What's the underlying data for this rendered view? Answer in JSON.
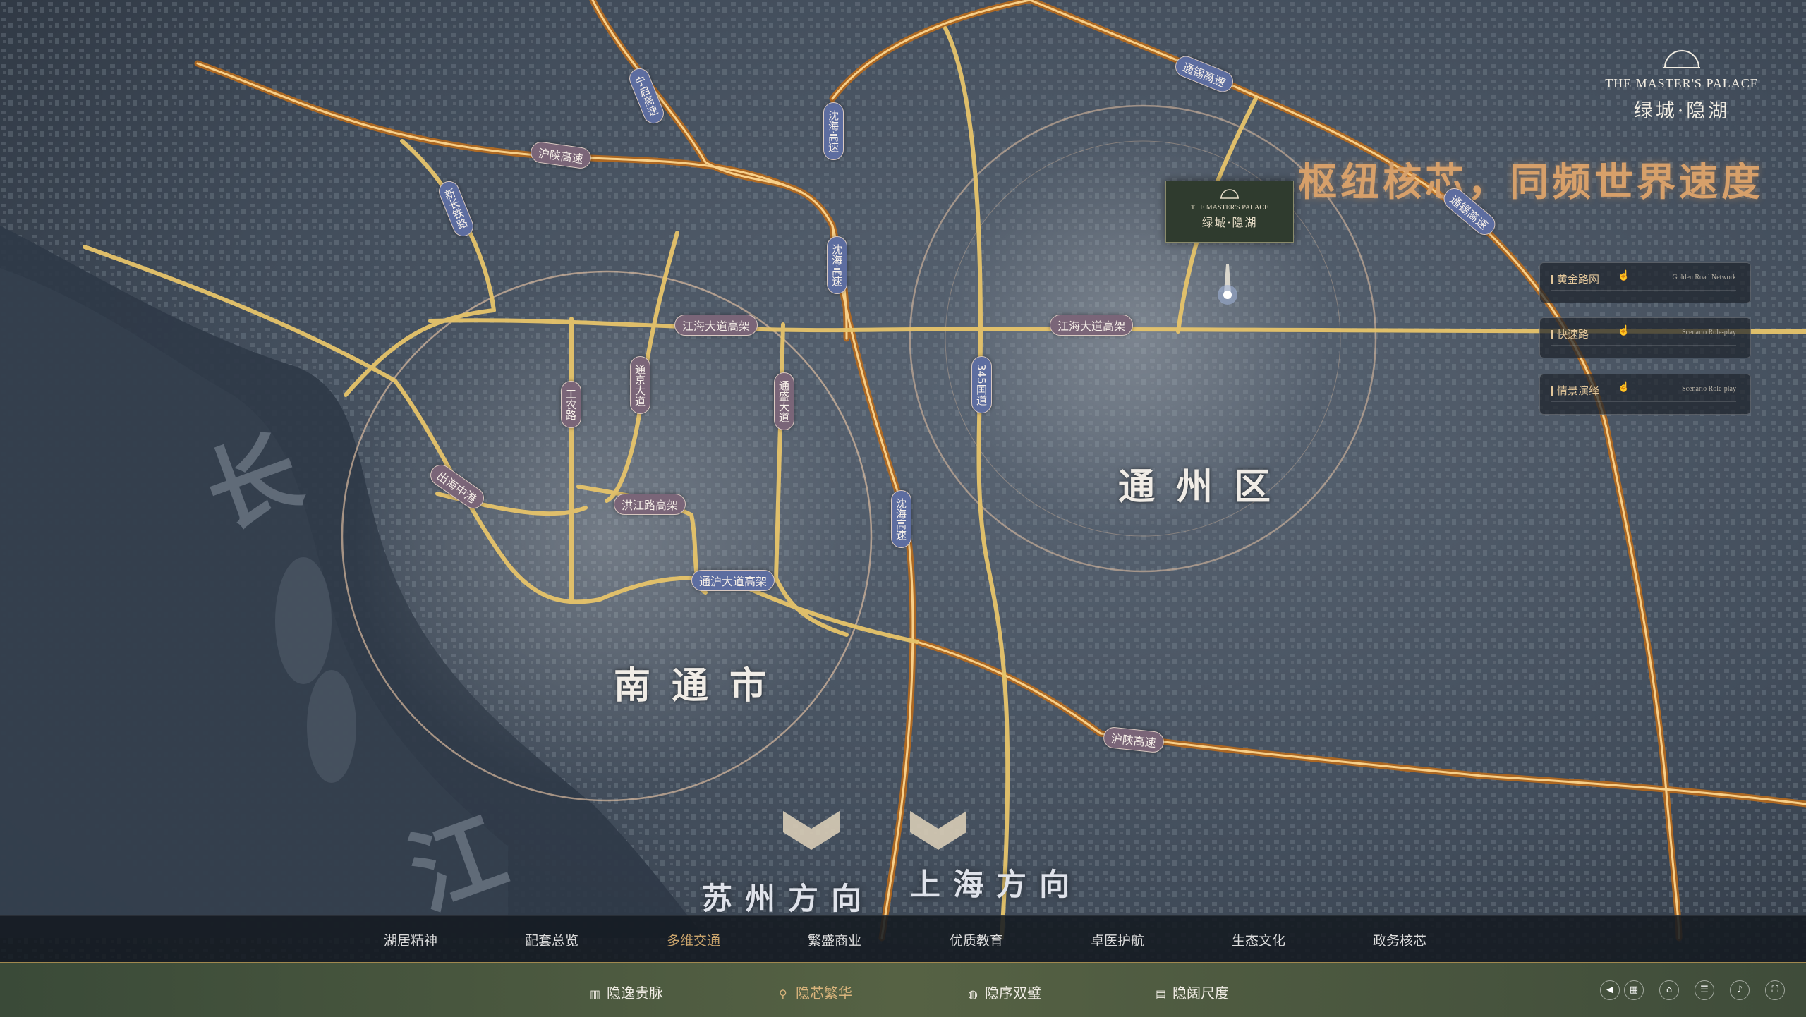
{
  "brand": {
    "name_en": "THE MASTER'S PALACE",
    "name_cn": "绿城·隐湖"
  },
  "headline": "枢纽核芯，同频世界速度",
  "marker": {
    "name_en": "THE MASTER'S PALACE",
    "name_cn": "绿城·隐湖"
  },
  "panels": [
    {
      "label": "黄金路网",
      "en": "Golden Road Network",
      "icon": "hand-pointer-icon"
    },
    {
      "label": "快速路",
      "en": "Scenario Role-play",
      "icon": "hand-pointer-icon"
    },
    {
      "label": "情景演绎",
      "en": "Scenario Role-play",
      "icon": "hand-pointer-icon"
    }
  ],
  "districts": {
    "tongzhou": "通州区",
    "nantong": "南通市"
  },
  "river": {
    "char1": "长",
    "char2": "江"
  },
  "roads": {
    "hushan_top": "沪陕高速",
    "hushan_bottom": "沪陕高速",
    "tongxi_1": "通锡高速",
    "tongxi_2": "通锡高速",
    "jianghai_west": "江海大道高架",
    "jianghai_east": "江海大道高架",
    "hongjiang": "洪江路高架",
    "tonghu": "通沪大道高架",
    "chuhai": "出海中港",
    "shenhai_1": "沈海高速",
    "shenhai_2": "沈海高速",
    "shenhai_3": "沈海高速",
    "gongnong": "工农路",
    "tongjing": "通京大道",
    "tongsheng": "通盛大道",
    "g345": "345国道",
    "ningqi": "宁启高速",
    "xinshiji": "新长铁路"
  },
  "directions": {
    "suzhou": "苏州方向",
    "shanghai": "上海方向"
  },
  "nav_primary": [
    {
      "label": "湖居精神",
      "active": false
    },
    {
      "label": "配套总览",
      "active": false
    },
    {
      "label": "多维交通",
      "active": true
    },
    {
      "label": "繁盛商业",
      "active": false
    },
    {
      "label": "优质教育",
      "active": false
    },
    {
      "label": "卓医护航",
      "active": false
    },
    {
      "label": "生态文化",
      "active": false
    },
    {
      "label": "政务核芯",
      "active": false
    }
  ],
  "nav_secondary": [
    {
      "label": "隐逸贵脉",
      "icon": "building-icon",
      "active": false
    },
    {
      "label": "隐芯繁华",
      "icon": "pin-icon",
      "active": true
    },
    {
      "label": "隐序双璧",
      "icon": "globe-icon",
      "active": false
    },
    {
      "label": "隐阔尺度",
      "icon": "chart-icon",
      "active": false
    }
  ],
  "tools": [
    {
      "icon": "back-icon",
      "glyph": "◀"
    },
    {
      "icon": "gallery-icon",
      "glyph": "▦"
    },
    {
      "icon": "home-icon",
      "glyph": "⌂"
    },
    {
      "icon": "menu-icon",
      "glyph": "☰"
    },
    {
      "icon": "sound-icon",
      "glyph": "♪"
    },
    {
      "icon": "fullscreen-icon",
      "glyph": "⛶"
    }
  ]
}
